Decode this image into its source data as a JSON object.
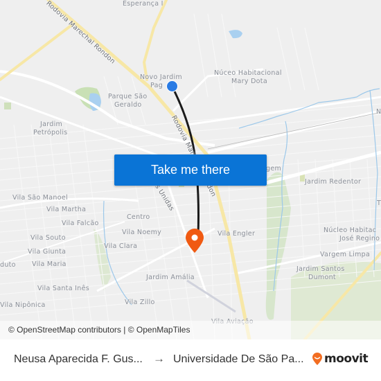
{
  "map": {
    "labels": [
      {
        "text": "Esperança I",
        "id": "esperanca-i"
      },
      {
        "text": "Novo Jardim",
        "id": "novo-jardim-1"
      },
      {
        "text": "Pag",
        "id": "novo-jardim-2"
      },
      {
        "text": "Núceo Habitacional",
        "id": "mary-dota-1"
      },
      {
        "text": "Mary Dota",
        "id": "mary-dota-2"
      },
      {
        "text": "Parque São",
        "id": "sao-geraldo-1"
      },
      {
        "text": "Geraldo",
        "id": "sao-geraldo-2"
      },
      {
        "text": "Jardim",
        "id": "petropolis-1"
      },
      {
        "text": "Petrópolis",
        "id": "petropolis-2"
      },
      {
        "text": "Vila São Manoel",
        "id": "sao-manoel"
      },
      {
        "text": "Vila Martha",
        "id": "martha"
      },
      {
        "text": "Vila Falcão",
        "id": "falcao"
      },
      {
        "text": "Centro",
        "id": "centro"
      },
      {
        "text": "Vila Noemy",
        "id": "noemy"
      },
      {
        "text": "Vila Souto",
        "id": "souto"
      },
      {
        "text": "Vila Clara",
        "id": "clara"
      },
      {
        "text": "Vila Giunta",
        "id": "giunta"
      },
      {
        "text": "duto",
        "id": "duto"
      },
      {
        "text": "Vila Maria",
        "id": "maria"
      },
      {
        "text": "Vila Engler",
        "id": "engler"
      },
      {
        "text": "Jardim Amália",
        "id": "amalia"
      },
      {
        "text": "Vila Santa Inês",
        "id": "santa-ines"
      },
      {
        "text": "Vila Zillo",
        "id": "zillo"
      },
      {
        "text": "Vila Nipônica",
        "id": "niponica"
      },
      {
        "text": "Vila Aviação",
        "id": "aviacao"
      },
      {
        "text": "Jardim Redentor",
        "id": "redentor"
      },
      {
        "text": "gem",
        "id": "gem"
      },
      {
        "text": "Núcleo Habitac",
        "id": "jose-regino-1"
      },
      {
        "text": "José Regino",
        "id": "jose-regino-2"
      },
      {
        "text": "Vargem Limpa",
        "id": "vargem-limpa"
      },
      {
        "text": "Jardim Santos",
        "id": "santos-dumont-1"
      },
      {
        "text": "Dumont",
        "id": "santos-dumont-2"
      },
      {
        "text": "N",
        "id": "n-edge"
      },
      {
        "text": "T",
        "id": "t-edge"
      }
    ],
    "road_labels": [
      {
        "text": "Rodovia Marechal Rondon",
        "id": "rondon-north"
      },
      {
        "text": "Rodovia Marechal Rondon",
        "id": "rondon-center"
      },
      {
        "text": "Av. Nações Unidas",
        "id": "nacoes-unidas"
      }
    ],
    "attribution": "© OpenStreetMap contributors | © OpenMapTiles",
    "cta_label": "Take me there",
    "colors": {
      "route": "#1a1a1a",
      "start": "#2a7be4",
      "destination": "#f05a12",
      "cta": "#0a74d6",
      "highway": "#f7e7a6"
    }
  },
  "footer": {
    "origin": "Neusa Aparecida F. Gus...",
    "arrow": "→",
    "destination": "Universidade De São Pa...",
    "brand": "moovit"
  }
}
